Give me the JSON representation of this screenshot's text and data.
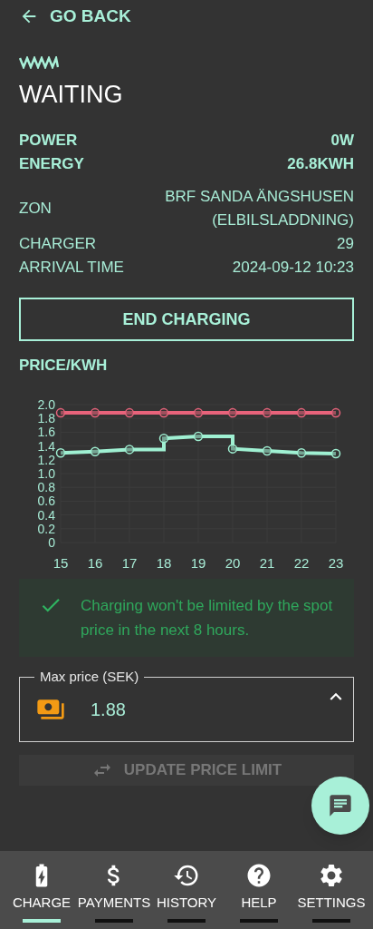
{
  "back": {
    "label": "GO BACK"
  },
  "status": "WAITING",
  "metrics": [
    {
      "label": "POWER",
      "value": "0W"
    },
    {
      "label": "ENERGY",
      "value": "26.8KWH"
    }
  ],
  "details": [
    {
      "label": "ZON",
      "value": "BRF SANDA ÄNGSHUSEN (ELBILSLADDNING)"
    },
    {
      "label": "CHARGER",
      "value": "29"
    },
    {
      "label": "ARRIVAL TIME",
      "value": "2024-09-12 10:23"
    }
  ],
  "end_button": "END CHARGING",
  "price_chart": {
    "title": "PRICE/KWH",
    "chart_data": {
      "type": "line",
      "grid": true,
      "x": [
        15,
        16,
        17,
        18,
        18,
        19,
        20,
        20,
        21,
        22,
        23
      ],
      "xlim": [
        15,
        23
      ],
      "ylim": [
        0,
        2
      ],
      "yticks": [
        {
          "value": 0,
          "label": "0"
        },
        {
          "value": 0.2,
          "label": "0.2"
        },
        {
          "value": 0.4,
          "label": "0.4"
        },
        {
          "value": 0.6,
          "label": "0.6"
        },
        {
          "value": 0.8,
          "label": "0.8"
        },
        {
          "value": 1,
          "label": "1.0"
        },
        {
          "value": 1.2,
          "label": "1.2"
        },
        {
          "value": 1.4,
          "label": "1.4"
        },
        {
          "value": 1.6,
          "label": "1.6"
        },
        {
          "value": 1.8,
          "label": "1.8"
        },
        {
          "value": 2,
          "label": "2.0"
        }
      ],
      "xticks": [
        15,
        16,
        17,
        18,
        19,
        20,
        21,
        22,
        23
      ],
      "series": [
        {
          "color": "#e8637b",
          "marker": "circle",
          "values": [
            1.88,
            1.88,
            1.88,
            1.88,
            1.88,
            1.88,
            1.88,
            1.88,
            1.88,
            1.88,
            1.88
          ]
        },
        {
          "color": "#9ff0d2",
          "marker": "circle",
          "values": [
            1.3,
            1.32,
            1.35,
            1.35,
            1.51,
            1.54,
            1.54,
            1.36,
            1.33,
            1.3,
            1.29
          ]
        }
      ]
    }
  },
  "notice": "Charging won't be limited by the spot price in the next 8 hours.",
  "max_price_field": {
    "label": "Max price (SEK)",
    "value": "1.88",
    "expanded": true
  },
  "update_button": "UPDATE PRICE LIMIT",
  "nav": [
    {
      "label": "CHARGE",
      "selected": true
    },
    {
      "label": "PAYMENTS",
      "selected": false
    },
    {
      "label": "HISTORY",
      "selected": false
    },
    {
      "label": "HELP",
      "selected": false
    },
    {
      "label": "SETTINGS",
      "selected": false
    }
  ]
}
